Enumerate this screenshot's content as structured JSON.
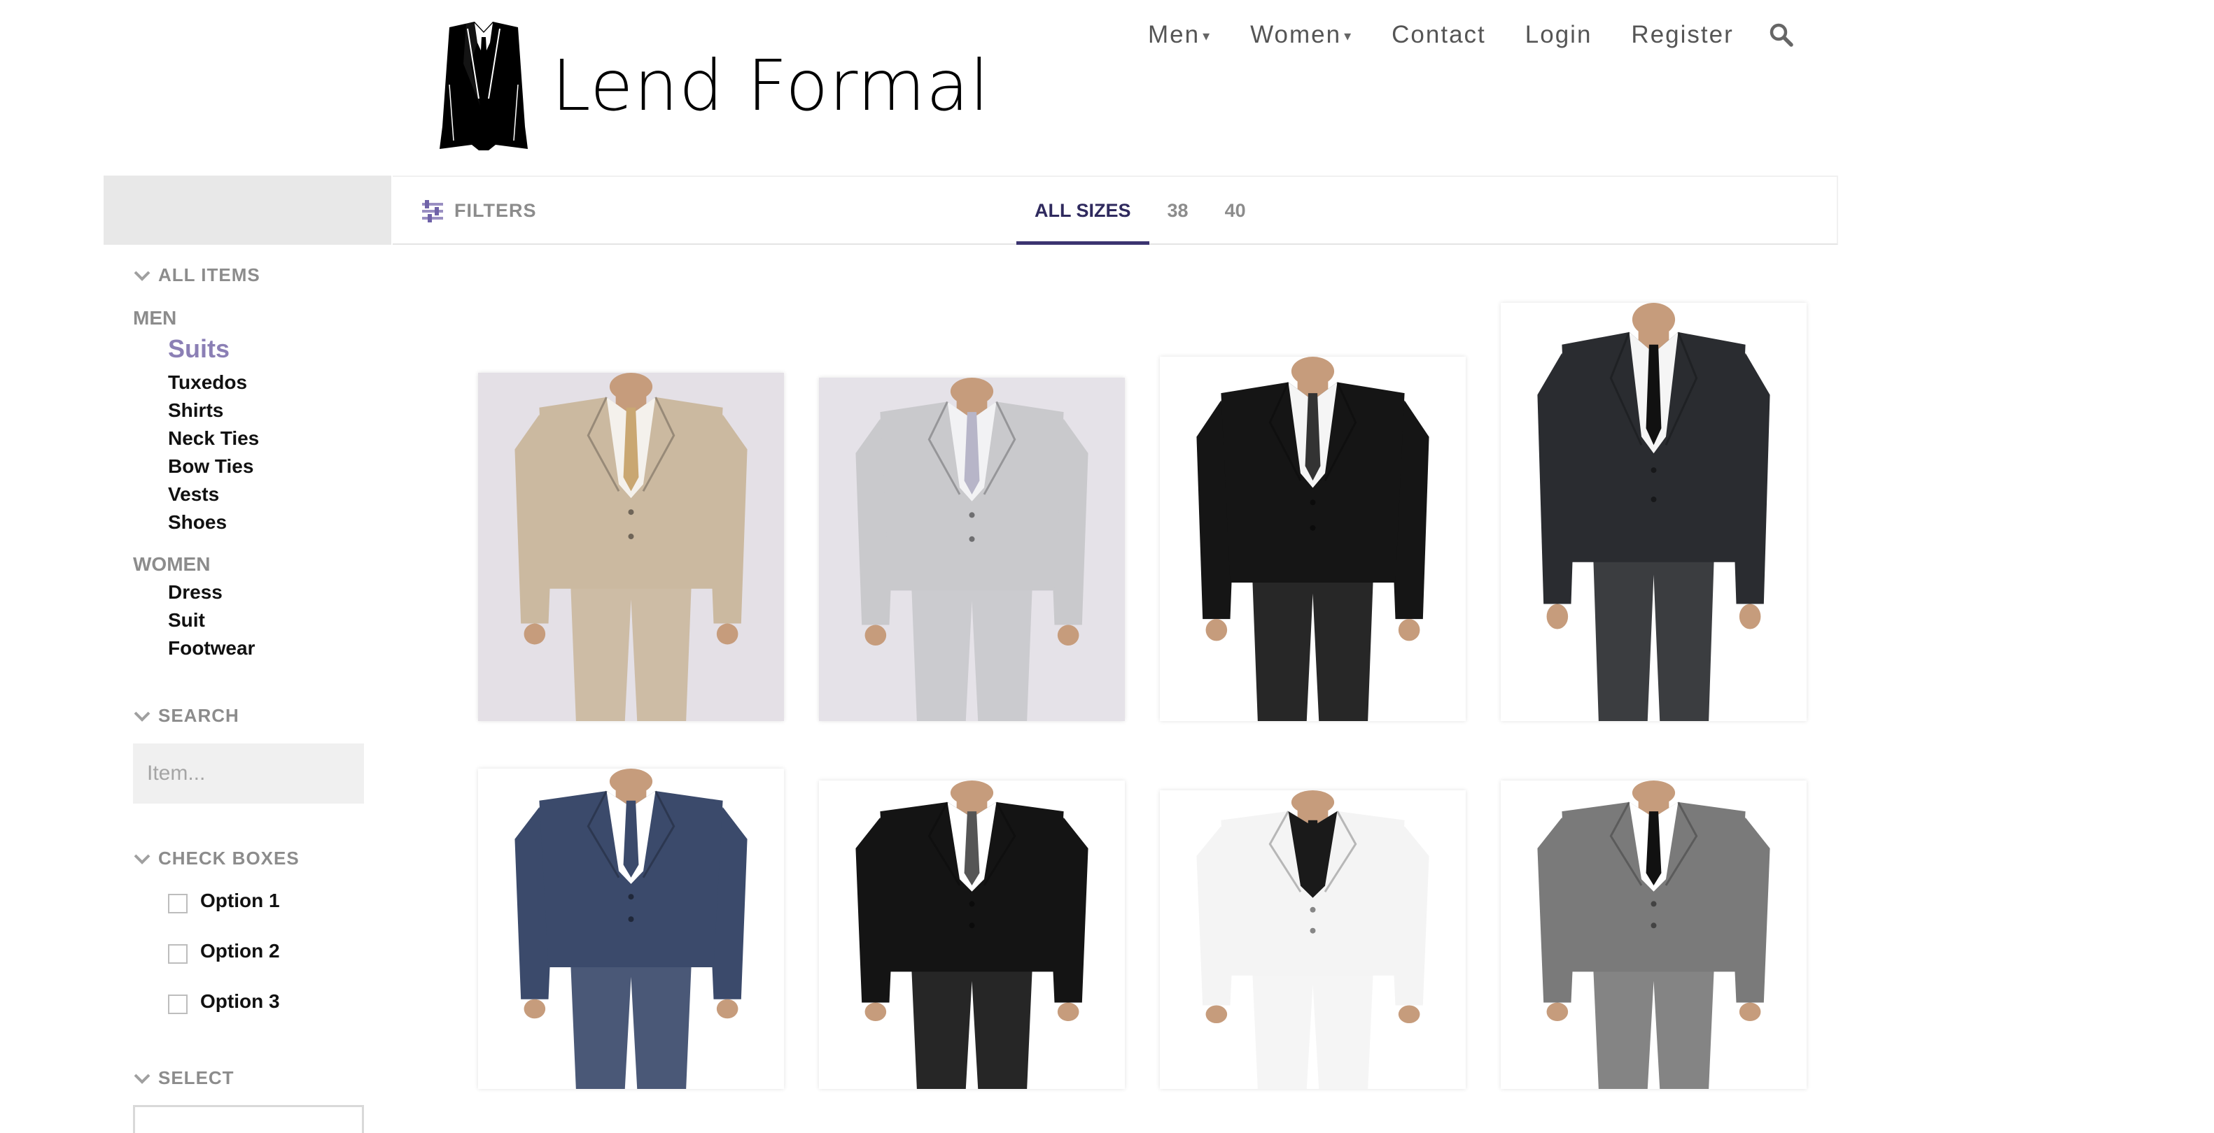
{
  "brand": {
    "name": "Lend Formal"
  },
  "nav": {
    "men": "Men",
    "women": "Women",
    "contact": "Contact",
    "login": "Login",
    "register": "Register"
  },
  "filter_bar": {
    "filters_label": "FILTERS",
    "sizes": [
      "ALL SIZES",
      "38",
      "40"
    ],
    "active_size": "ALL SIZES"
  },
  "sidebar": {
    "all_items": "ALL ITEMS",
    "men_label": "MEN",
    "men_items": [
      "Suits",
      "Tuxedos",
      "Shirts",
      "Neck Ties",
      "Bow Ties",
      "Vests",
      "Shoes"
    ],
    "active_item": "Suits",
    "women_label": "WOMEN",
    "women_items": [
      "Dress",
      "Suit",
      "Footwear"
    ],
    "search_label": "SEARCH",
    "search_placeholder": "Item...",
    "checkboxes_label": "CHECK BOXES",
    "options": [
      "Option 1",
      "Option 2",
      "Option 3"
    ],
    "select_label": "SELECT"
  },
  "products": [
    {
      "name": "beige-suit",
      "jacket": "#cbb9a0",
      "shirt": "#f4f1ec",
      "tie": "#c9a772",
      "bg": "#e4e0e6"
    },
    {
      "name": "silver-suit",
      "jacket": "#c9c9cc",
      "shirt": "#f2f2f4",
      "tie": "#b7b5c8",
      "bg": "#e5e2e8"
    },
    {
      "name": "black-suit",
      "jacket": "#151515",
      "shirt": "#f5f5f5",
      "tie": "#333333",
      "bg": "#ffffff"
    },
    {
      "name": "pinstripe-tuxedo",
      "jacket": "#2a2c30",
      "shirt": "#f5f5f5",
      "tie": "#111111",
      "bg": "#ffffff"
    },
    {
      "name": "navy-three-piece-suit",
      "jacket": "#3b4a6b",
      "shirt": "#ffffff",
      "tie": "#3b4a6b",
      "bg": "#ffffff"
    },
    {
      "name": "black-slim-suit",
      "jacket": "#141414",
      "shirt": "#ffffff",
      "tie": "#555555",
      "bg": "#ffffff"
    },
    {
      "name": "white-suit",
      "jacket": "#f4f4f4",
      "shirt": "#1a1a1a",
      "tie": "#1a1a1a",
      "bg": "#ffffff"
    },
    {
      "name": "grey-three-piece-suit",
      "jacket": "#7a7a7a",
      "shirt": "#ffffff",
      "tie": "#111111",
      "bg": "#ffffff"
    }
  ],
  "colors": {
    "accent": "#8b7fb5",
    "tab_active": "#3b3470",
    "muted": "#8c8c8c"
  }
}
